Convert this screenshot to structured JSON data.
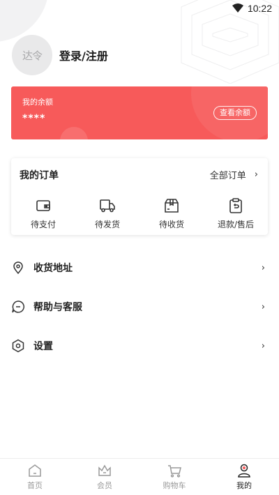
{
  "status_bar": {
    "time": "10:22",
    "icons": [
      "wifi-icon"
    ]
  },
  "profile": {
    "avatar_text": "达令",
    "login_label": "登录/注册"
  },
  "balance": {
    "label": "我的余额",
    "value": "****",
    "button": "查看余额",
    "color": "#f75a5a"
  },
  "orders": {
    "title": "我的订单",
    "all_label": "全部订单",
    "items": [
      {
        "label": "待支付",
        "icon": "wallet-icon"
      },
      {
        "label": "待发货",
        "icon": "truck-icon"
      },
      {
        "label": "待收货",
        "icon": "package-icon"
      },
      {
        "label": "退款/售后",
        "icon": "refund-icon"
      }
    ]
  },
  "menu": [
    {
      "label": "收货地址",
      "icon": "location-icon"
    },
    {
      "label": "帮助与客服",
      "icon": "chat-icon"
    },
    {
      "label": "设置",
      "icon": "settings-icon"
    }
  ],
  "tabs": [
    {
      "label": "首页",
      "icon": "home-icon",
      "active": false
    },
    {
      "label": "会员",
      "icon": "crown-icon",
      "active": false
    },
    {
      "label": "购物车",
      "icon": "cart-icon",
      "active": false
    },
    {
      "label": "我的",
      "icon": "user-icon",
      "active": true
    }
  ],
  "colors": {
    "accent": "#f75a5a",
    "active_tab": "#222222",
    "inactive_tab": "#999999"
  }
}
